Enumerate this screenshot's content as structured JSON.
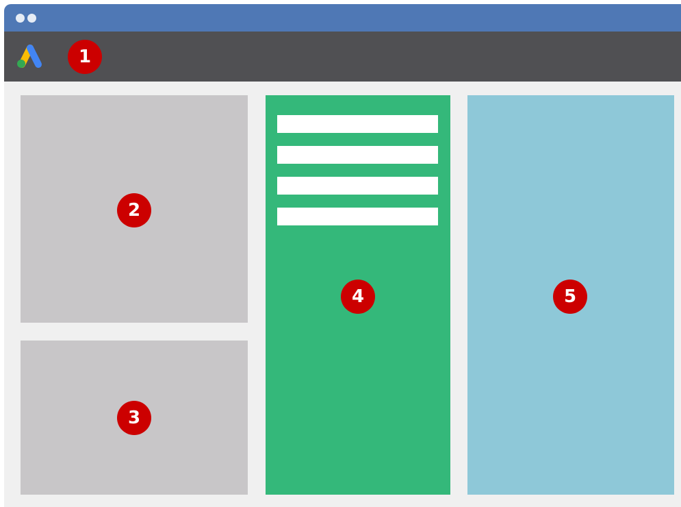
{
  "colors": {
    "titlebar": "#4f78b5",
    "toolbar": "#505053",
    "background": "#f0f0f0",
    "gray_panel": "#c8c6c8",
    "green_panel": "#34b87a",
    "blue_panel": "#8ec8d8",
    "badge": "#cc0000",
    "menu_bar": "#ffffff"
  },
  "window": {
    "controls": [
      "window-dot",
      "window-dot"
    ]
  },
  "toolbar": {
    "logo_icon": "google-ads-logo-icon",
    "marker": "1"
  },
  "panels": {
    "top_left": {
      "marker": "2"
    },
    "bottom_left": {
      "marker": "3"
    },
    "middle": {
      "marker": "4",
      "menu_bar_count": 4
    },
    "right": {
      "marker": "5"
    }
  }
}
